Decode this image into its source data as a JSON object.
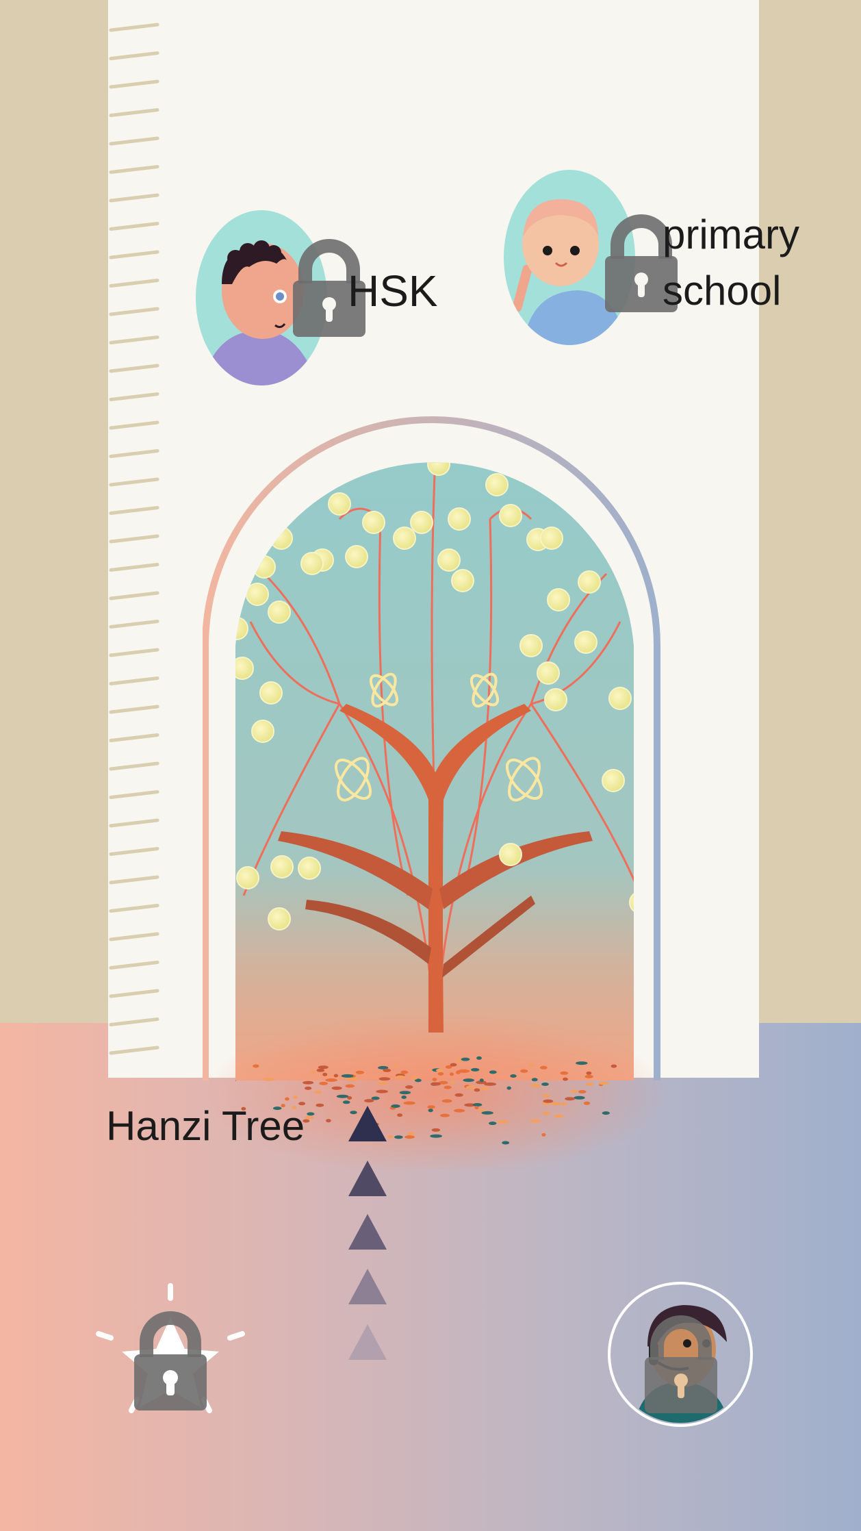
{
  "levels": {
    "hsk": {
      "label": "HSK",
      "locked": true,
      "icon": "boy-avatar-icon"
    },
    "primary_school": {
      "label": "primary school",
      "locked": true,
      "icon": "girl-avatar-icon"
    }
  },
  "main": {
    "title": "Hanzi Tree",
    "scene": "tree-arch-icon",
    "progress_arrows": 5
  },
  "bottom": {
    "achievement": {
      "icon": "star-icon",
      "locked": true
    },
    "tutor": {
      "icon": "tutor-avatar-icon"
    }
  },
  "colors": {
    "panel": "#f8f6f0",
    "side": "#dbcdaf",
    "gradient_left": "#f4b6a2",
    "gradient_right": "#a0b0cc",
    "arrow": "#2c2f4d",
    "lock": "#6e6e6e"
  }
}
